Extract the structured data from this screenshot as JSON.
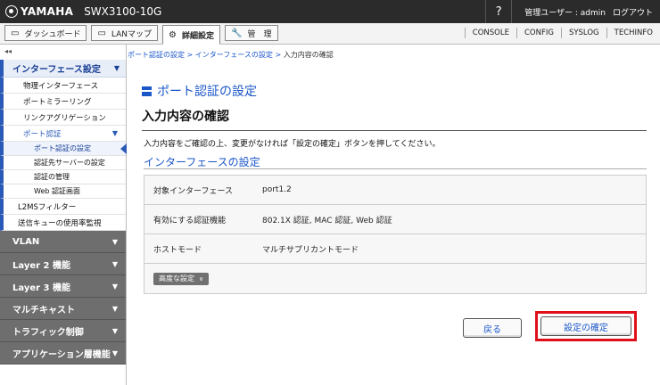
{
  "header": {
    "brand": "YAMAHA",
    "model": "SWX3100-10G",
    "help": "?",
    "user": "管理ユーザー : admin",
    "logout": "ログアウト"
  },
  "tabs": [
    {
      "icon": "▭",
      "label": "ダッシュボード"
    },
    {
      "icon": "▭",
      "label": "LANマップ"
    },
    {
      "icon": "⚙",
      "label": "詳細設定"
    },
    {
      "icon": "🔧",
      "label": "管　理"
    }
  ],
  "tab_links": [
    "CONSOLE",
    "CONFIG",
    "SYSLOG",
    "TECHINFO"
  ],
  "sidebar": {
    "collapse": "◂◂",
    "section": "インターフェース設定",
    "items": [
      "物理インターフェース",
      "ポートミラーリング",
      "リンクアグリゲーション"
    ],
    "sub": "ポート認証",
    "subitems": [
      "ポート認証の設定",
      "認証先サーバーの設定",
      "認証の管理",
      "Web 認証画面"
    ],
    "after": [
      "L2MSフィルター",
      "送信キューの使用率監視"
    ],
    "categories": [
      "VLAN",
      "Layer 2 機能",
      "Layer 3 機能",
      "マルチキャスト",
      "トラフィック制御",
      "アプリケーション層機能"
    ],
    "arrow": "▼"
  },
  "breadcrumb": {
    "link1": "ポート認証の設定",
    "sep": ">",
    "link2": "インターフェースの設定",
    "current": "入力内容の確認"
  },
  "page_title": "ポート認証の設定",
  "sub_title": "入力内容の確認",
  "description": "入力内容をご確認の上、変更がなければ「設定の確定」ボタンを押してください。",
  "section_title": "インターフェースの設定",
  "rows": [
    {
      "label": "対象インターフェース",
      "value": "port1.2"
    },
    {
      "label": "有効にする認証機能",
      "value": "802.1X 認証, MAC 認証, Web 認証"
    },
    {
      "label": "ホストモード",
      "value": "マルチサプリカントモード"
    }
  ],
  "advanced": "高度な設定",
  "buttons": {
    "back": "戻る",
    "confirm": "設定の確定"
  },
  "colors": {
    "accent": "#1a56c8",
    "highlight": "#e0101a"
  }
}
